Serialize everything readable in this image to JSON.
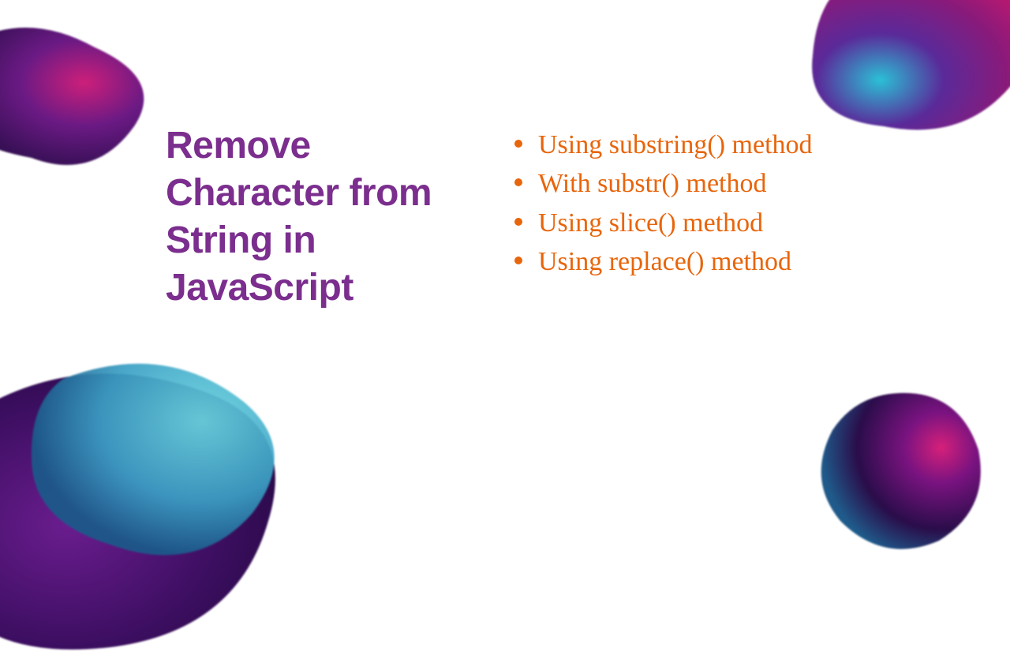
{
  "heading": "Remove Character from String in JavaScript",
  "items": [
    "Using substring() method",
    "With substr() method",
    "Using slice() method",
    "Using replace() method"
  ]
}
